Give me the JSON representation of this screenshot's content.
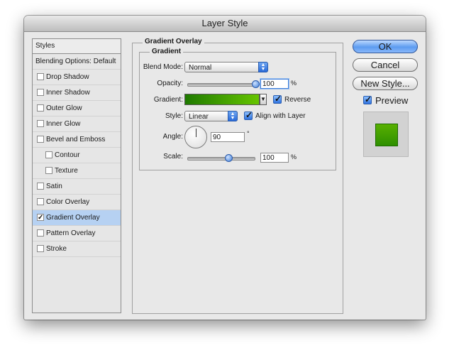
{
  "window": {
    "title": "Layer Style"
  },
  "sidebar": {
    "header": "Styles",
    "items": [
      {
        "label": "Blending Options: Default",
        "checkbox": false,
        "checked": false,
        "selected": false,
        "indent": 0
      },
      {
        "label": "Drop Shadow",
        "checkbox": true,
        "checked": false,
        "selected": false,
        "indent": 0
      },
      {
        "label": "Inner Shadow",
        "checkbox": true,
        "checked": false,
        "selected": false,
        "indent": 0
      },
      {
        "label": "Outer Glow",
        "checkbox": true,
        "checked": false,
        "selected": false,
        "indent": 0
      },
      {
        "label": "Inner Glow",
        "checkbox": true,
        "checked": false,
        "selected": false,
        "indent": 0
      },
      {
        "label": "Bevel and Emboss",
        "checkbox": true,
        "checked": false,
        "selected": false,
        "indent": 0
      },
      {
        "label": "Contour",
        "checkbox": true,
        "checked": false,
        "selected": false,
        "indent": 1
      },
      {
        "label": "Texture",
        "checkbox": true,
        "checked": false,
        "selected": false,
        "indent": 1
      },
      {
        "label": "Satin",
        "checkbox": true,
        "checked": false,
        "selected": false,
        "indent": 0
      },
      {
        "label": "Color Overlay",
        "checkbox": true,
        "checked": false,
        "selected": false,
        "indent": 0
      },
      {
        "label": "Gradient Overlay",
        "checkbox": true,
        "checked": true,
        "selected": true,
        "indent": 0
      },
      {
        "label": "Pattern Overlay",
        "checkbox": true,
        "checked": false,
        "selected": false,
        "indent": 0
      },
      {
        "label": "Stroke",
        "checkbox": true,
        "checked": false,
        "selected": false,
        "indent": 0
      }
    ]
  },
  "panel": {
    "title": "Gradient Overlay",
    "group_title": "Gradient",
    "blend_mode": {
      "label": "Blend Mode:",
      "value": "Normal"
    },
    "opacity": {
      "label": "Opacity:",
      "value": "100",
      "unit": "%",
      "level": 1.0
    },
    "gradient": {
      "label": "Gradient:",
      "reverse_label": "Reverse",
      "reverse_checked": true,
      "color_start": "#1f7a00",
      "color_end": "#66c400"
    },
    "style": {
      "label": "Style:",
      "value": "Linear",
      "align_label": "Align with Layer",
      "align_checked": true
    },
    "angle": {
      "label": "Angle:",
      "value": "90",
      "unit": "°"
    },
    "scale": {
      "label": "Scale:",
      "value": "100",
      "unit": "%",
      "level": 0.62
    }
  },
  "buttons": {
    "ok": "OK",
    "cancel": "Cancel",
    "new_style": "New Style...",
    "preview_label": "Preview",
    "preview_checked": true
  },
  "colors": {
    "selection": "#b6d1f2",
    "accent_blue": "#3f7fd9",
    "preview_green": "#3f9f00"
  }
}
